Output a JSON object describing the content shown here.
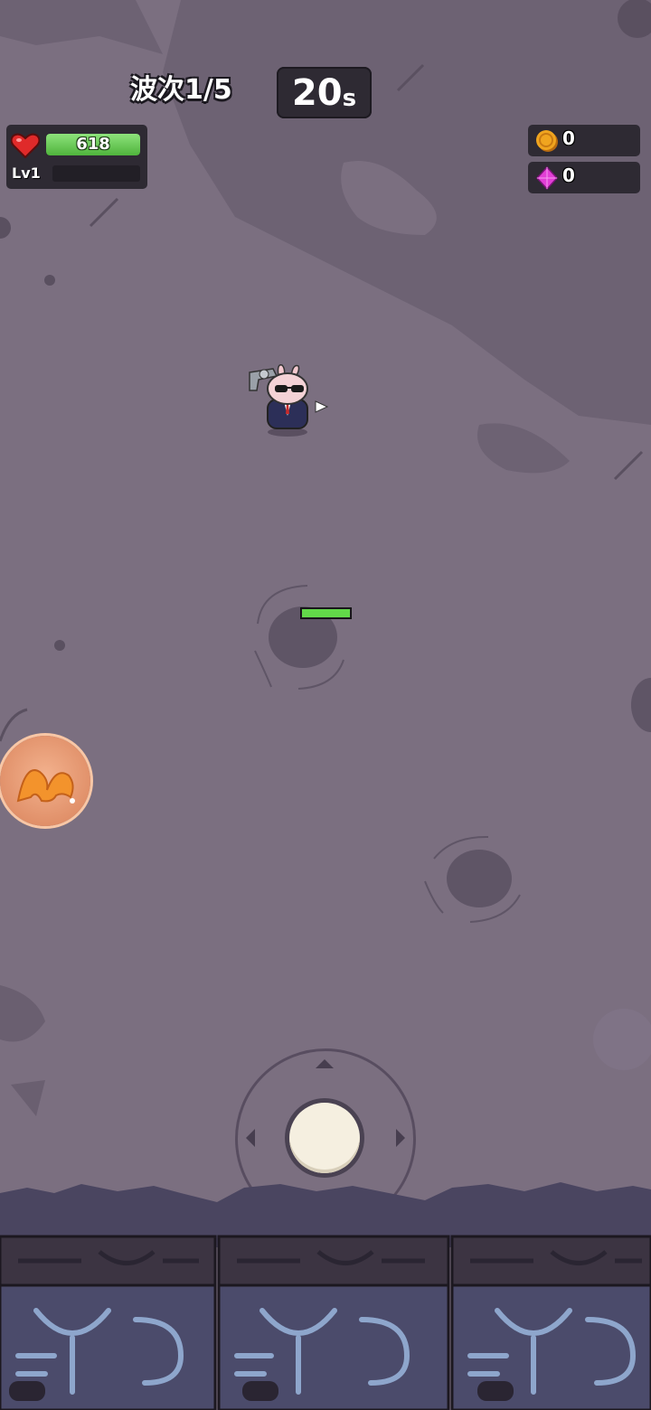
{
  "hud": {
    "wave_label": "波次1/5",
    "timer_value": "20",
    "timer_unit": "s",
    "hp": "618",
    "hp_fraction": 1.0,
    "level": "Lv1",
    "xp_fraction": 0.0,
    "coins": "0",
    "gems": "0"
  },
  "icons": {
    "heart": "heart-icon",
    "coin": "coin-icon",
    "gem": "gem-icon",
    "skill": "skill-icon"
  },
  "enemy": {
    "hp_fraction": 1.0
  },
  "colors": {
    "ground": "#7b6f80",
    "hp_green": "#4fb43c",
    "panel": "#2e2a33",
    "gem": "#e23fd6",
    "coin": "#f0a51f",
    "heart": "#e02a2a"
  }
}
